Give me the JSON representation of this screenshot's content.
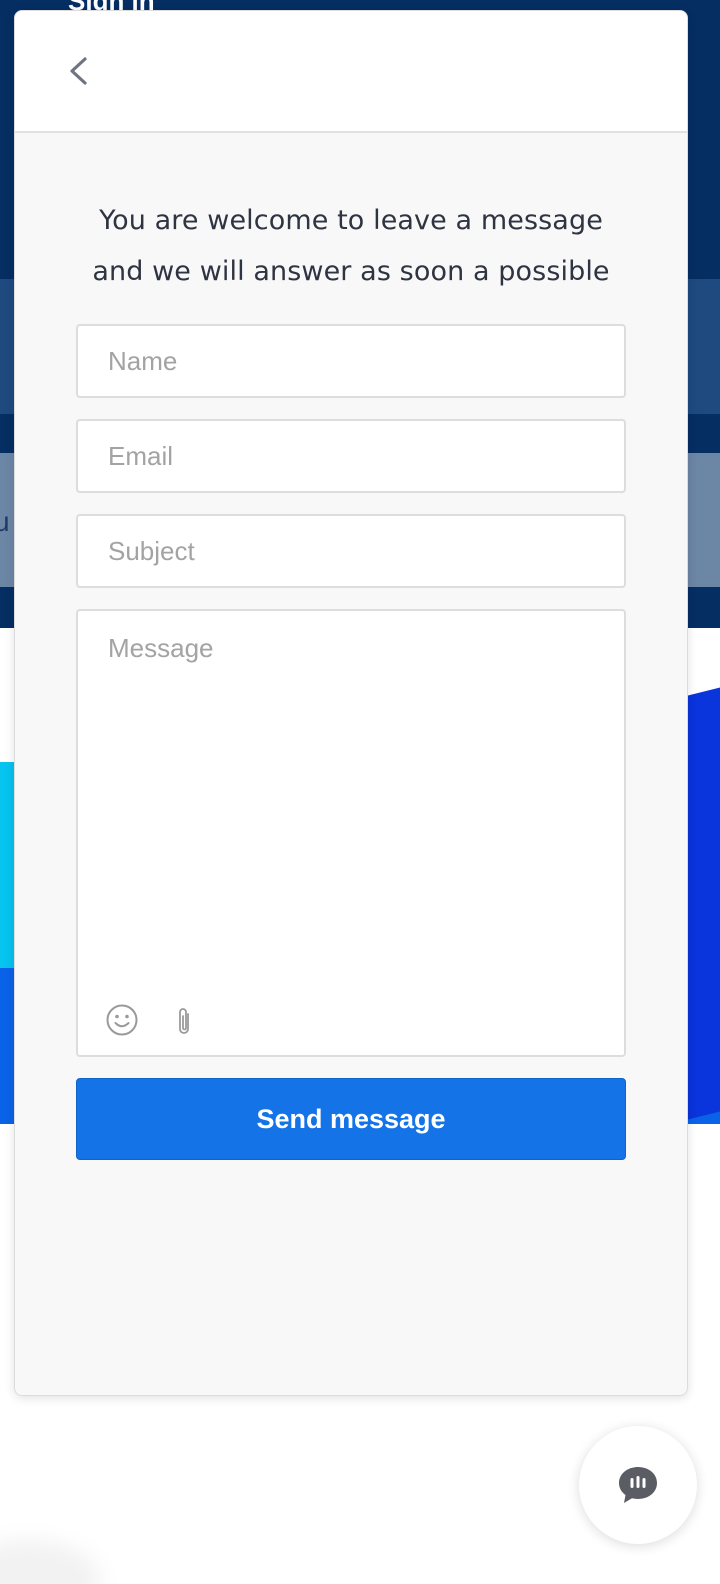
{
  "background": {
    "signin_text": "Sign in",
    "band_text": "u"
  },
  "header": {
    "back_icon": "chevron-left-icon"
  },
  "intro": {
    "line1": "You are welcome to leave a message",
    "line2": "and we will answer as soon a possible"
  },
  "form": {
    "name_placeholder": "Name",
    "name_value": "",
    "email_placeholder": "Email",
    "email_value": "",
    "subject_placeholder": "Subject",
    "subject_value": "",
    "message_placeholder": "Message",
    "message_value": "",
    "emoji_icon": "smiley-icon",
    "attach_icon": "paperclip-icon",
    "send_label": "Send message"
  },
  "launcher": {
    "icon": "chat-bubble-icon"
  },
  "colors": {
    "accent": "#1473e6",
    "hero_background": "#052e63",
    "panel_background": "#f8f8f8"
  }
}
